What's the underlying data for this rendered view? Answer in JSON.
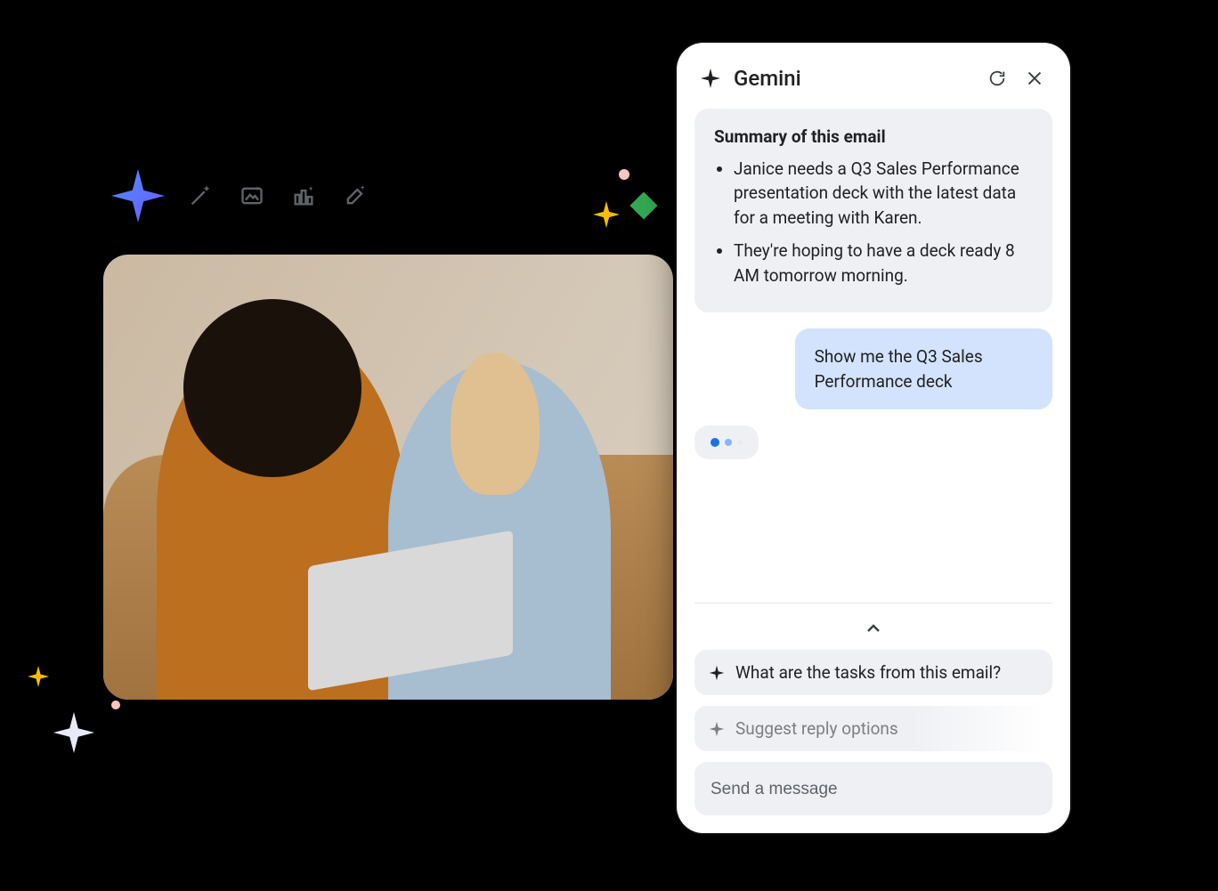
{
  "toolbar_icons": {
    "names": [
      "magic-wand-icon",
      "image-sparkle-icon",
      "chart-column-icon",
      "brush-sparkle-icon"
    ]
  },
  "gemini": {
    "title": "Gemini",
    "summary": {
      "heading": "Summary of this email",
      "bullets": [
        "Janice needs a Q3 Sales Performance presentation deck with the latest data for a meeting with Karen.",
        "They're hoping to have a deck ready 8 AM tomorrow morning."
      ]
    },
    "user_message": "Show me the Q3 Sales Performance deck",
    "suggestions": [
      "What are the tasks from this email?",
      "Suggest reply options"
    ],
    "composer_placeholder": "Send a message"
  },
  "photo_alt": "Two women looking at a laptop on a sofa"
}
